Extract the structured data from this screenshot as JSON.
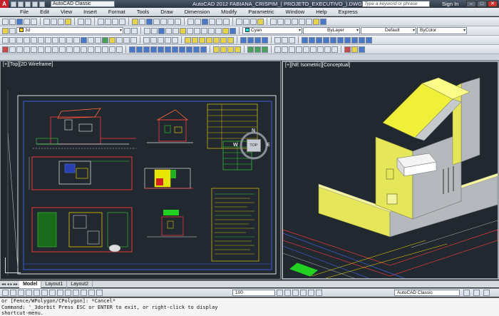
{
  "titlebar": {
    "logo": "A",
    "workspace": "AutoCAD Classic",
    "title": "AutoCAD 2012   FABIANA_CRISPIM_( PROJETO_EXECUTIVO_).DWG",
    "search_placeholder": "Type a keyword or phrase",
    "signin": "Sign In",
    "min": "–",
    "max": "□",
    "close": "✕"
  },
  "menu": [
    "File",
    "Edit",
    "View",
    "Insert",
    "Format",
    "Tools",
    "Draw",
    "Dimension",
    "Modify",
    "Parametric",
    "Window",
    "Help",
    "Express"
  ],
  "toolbars": {
    "layer_combo": "3d",
    "color_combo": "Cyan",
    "linetype_combo": "ByLayer",
    "lineweight_combo": "Default",
    "plotstyle_combo": "ByColor"
  },
  "viewports": {
    "left_label": "[+][Top][2D Wireframe]",
    "right_label": "[+][NE Isometric][Conceptual]",
    "viewcube": {
      "north": "N",
      "east": "E",
      "west": "W",
      "face": "TOP"
    }
  },
  "layout_tabs": [
    "Model",
    "Layout1",
    "Layout2"
  ],
  "tab_nav": "◂◂ ◂ ▸ ▸▸",
  "statusbar": {
    "zoom": "100",
    "workspace": "AutoCAD Classic"
  },
  "command_lines": [
    "or [Fence/WPolygon/CPolygon]: *Cancel*",
    "Command: '_3dorbit Press ESC or ENTER to exit, or right-click to display",
    "shortcut-menu."
  ],
  "colors": {
    "model_bg": "#212830",
    "building_yellow": "#e6e65a",
    "building_gray": "#b5b9bd"
  }
}
